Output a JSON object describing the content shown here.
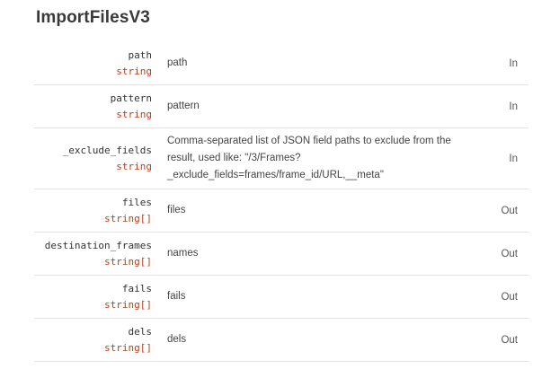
{
  "title": "ImportFilesV3",
  "fields": [
    {
      "name": "path",
      "type": "string",
      "description": "path",
      "direction": "In"
    },
    {
      "name": "pattern",
      "type": "string",
      "description": "pattern",
      "direction": "In"
    },
    {
      "name": "_exclude_fields",
      "type": "string",
      "description": "Comma-separated list of JSON field paths to exclude from the result, used like: \"/3/Frames?_exclude_fields=frames/frame_id/URL,__meta\"",
      "direction": "In"
    },
    {
      "name": "files",
      "type": "string[]",
      "description": "files",
      "direction": "Out"
    },
    {
      "name": "destination_frames",
      "type": "string[]",
      "description": "names",
      "direction": "Out"
    },
    {
      "name": "fails",
      "type": "string[]",
      "description": "fails",
      "direction": "Out"
    },
    {
      "name": "dels",
      "type": "string[]",
      "description": "dels",
      "direction": "Out"
    }
  ]
}
